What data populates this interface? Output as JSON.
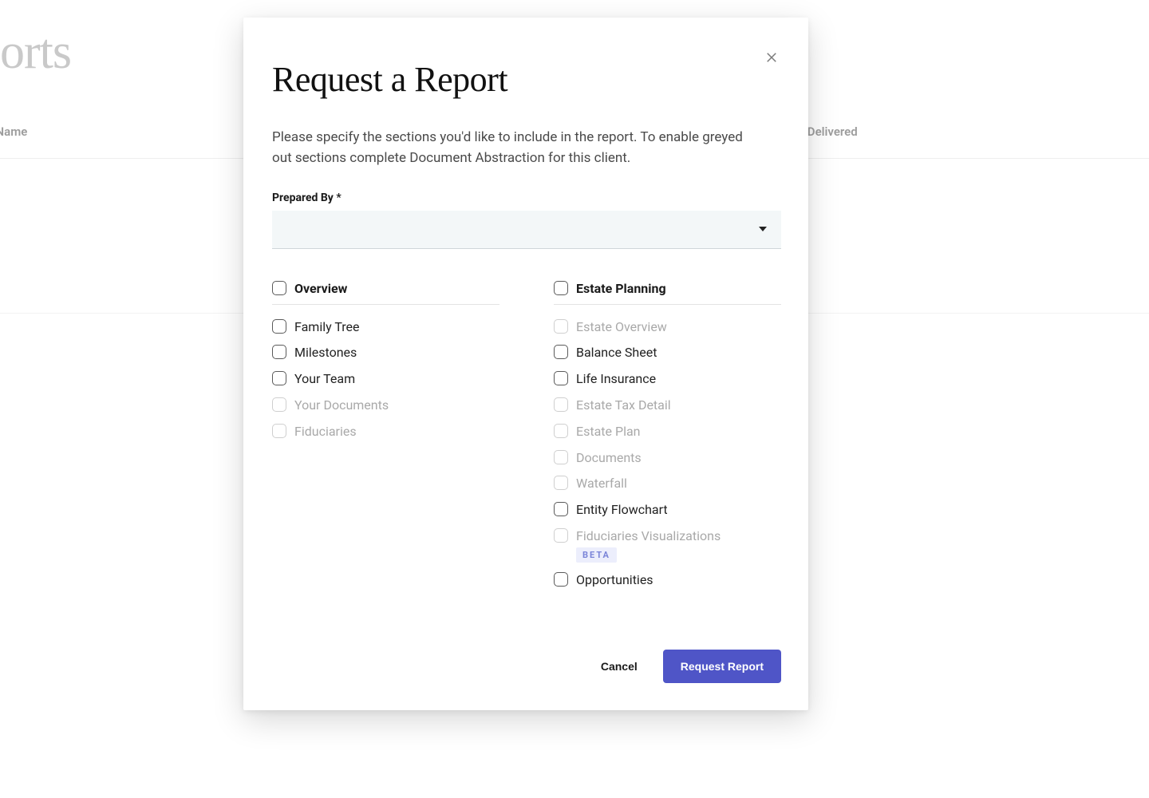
{
  "background": {
    "page_title_partial": "ports",
    "col_left": "rt Name",
    "col_right": "e Delivered"
  },
  "modal": {
    "title": "Request a Report",
    "description": "Please specify the sections you'd like to include in the report. To enable greyed out sections complete Document Abstraction for this client.",
    "prepared_by_label": "Prepared By *",
    "prepared_by_value": "",
    "sections": {
      "overview": {
        "title": "Overview",
        "items": [
          {
            "label": "Family Tree",
            "enabled": true
          },
          {
            "label": "Milestones",
            "enabled": true
          },
          {
            "label": "Your Team",
            "enabled": true
          },
          {
            "label": "Your Documents",
            "enabled": false
          },
          {
            "label": "Fiduciaries",
            "enabled": false
          }
        ]
      },
      "estate": {
        "title": "Estate Planning",
        "items": [
          {
            "label": "Estate Overview",
            "enabled": false
          },
          {
            "label": "Balance Sheet",
            "enabled": true
          },
          {
            "label": "Life Insurance",
            "enabled": true
          },
          {
            "label": "Estate Tax Detail",
            "enabled": false
          },
          {
            "label": "Estate Plan",
            "enabled": false
          },
          {
            "label": "Documents",
            "enabled": false
          },
          {
            "label": "Waterfall",
            "enabled": false
          },
          {
            "label": "Entity Flowchart",
            "enabled": true
          },
          {
            "label": "Fiduciaries Visualizations",
            "enabled": false,
            "badge": "BETA"
          },
          {
            "label": "Opportunities",
            "enabled": true
          }
        ]
      }
    },
    "buttons": {
      "cancel": "Cancel",
      "submit": "Request Report"
    }
  }
}
